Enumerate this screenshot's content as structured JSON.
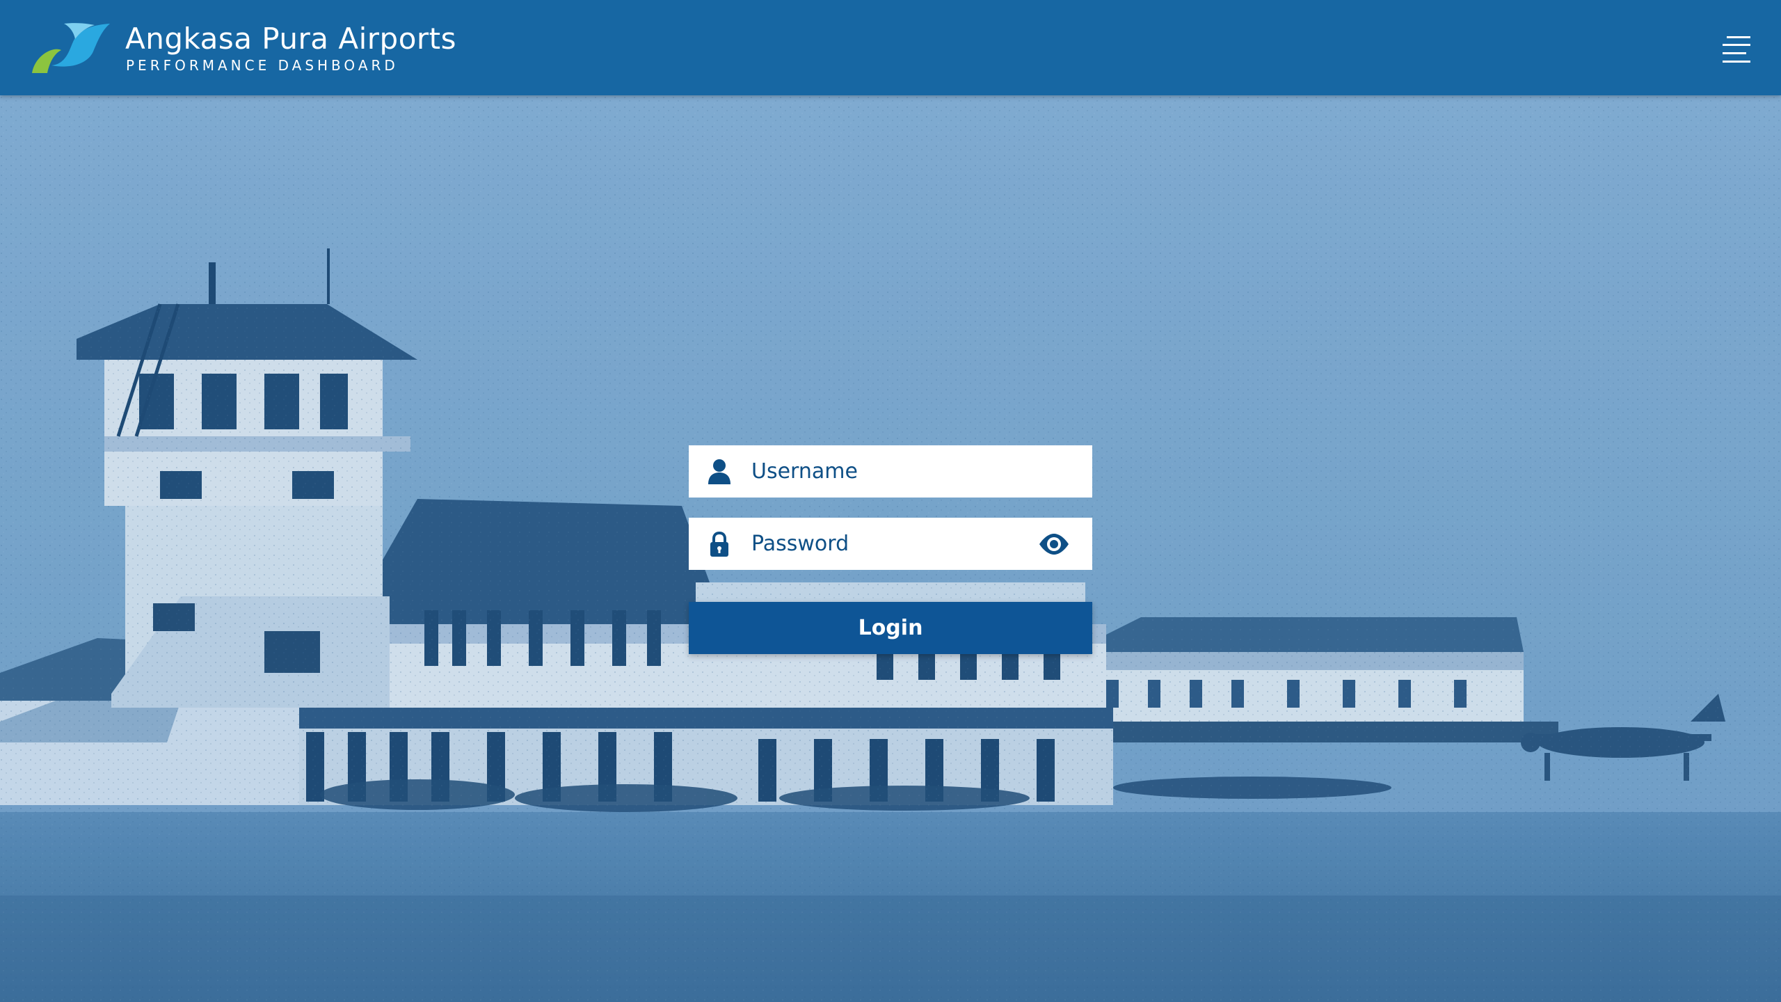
{
  "header": {
    "title": "Angkasa Pura Airports",
    "subtitle": "PERFORMANCE DASHBOARD",
    "logo_icon": "angkasa-pura-logo",
    "menu_icon": "hamburger-menu-icon"
  },
  "login": {
    "username_placeholder": "Username",
    "username_value": "",
    "username_icon": "user-icon",
    "password_placeholder": "Password",
    "password_value": "",
    "password_icon": "lock-icon",
    "show_password_icon": "eye-icon",
    "submit_label": "Login"
  },
  "colors": {
    "header_bg": "#1767a3",
    "background_tint": "#7ea9cf",
    "button_bg": "#0e5596",
    "text_blue": "#0e4f86",
    "logo_blue": "#2aa8e0",
    "logo_green": "#8cc43f"
  }
}
